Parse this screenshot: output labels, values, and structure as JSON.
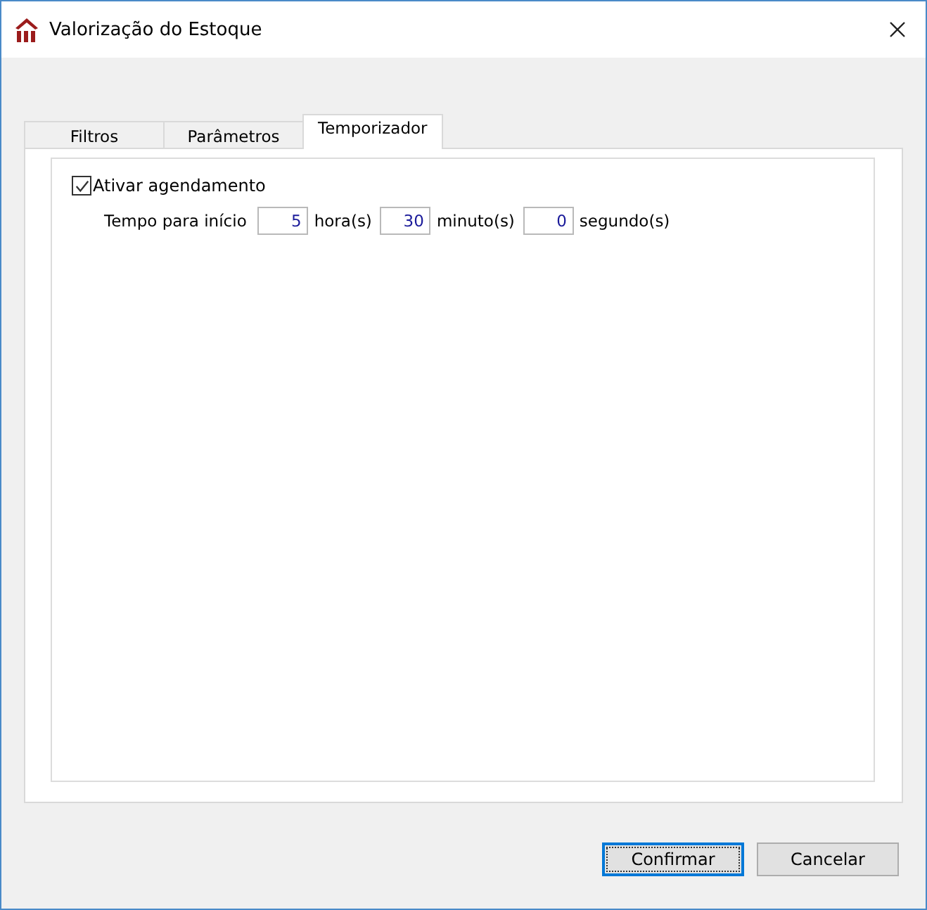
{
  "window": {
    "title": "Valorização do Estoque"
  },
  "tabs": [
    {
      "label": "Filtros",
      "selected": false
    },
    {
      "label": "Parâmetros",
      "selected": false
    },
    {
      "label": "Temporizador",
      "selected": true
    }
  ],
  "schedule": {
    "label": "Ativar agendamento",
    "checked": true
  },
  "start_time": {
    "label": "Tempo para início",
    "fields": [
      {
        "value": "5",
        "unit": "hora(s)"
      },
      {
        "value": "30",
        "unit": "minuto(s)"
      },
      {
        "value": "0",
        "unit": "segundo(s)"
      }
    ]
  },
  "buttons": [
    {
      "label": "Confirmar",
      "focused": true
    },
    {
      "label": "Cancelar",
      "focused": false
    }
  ]
}
